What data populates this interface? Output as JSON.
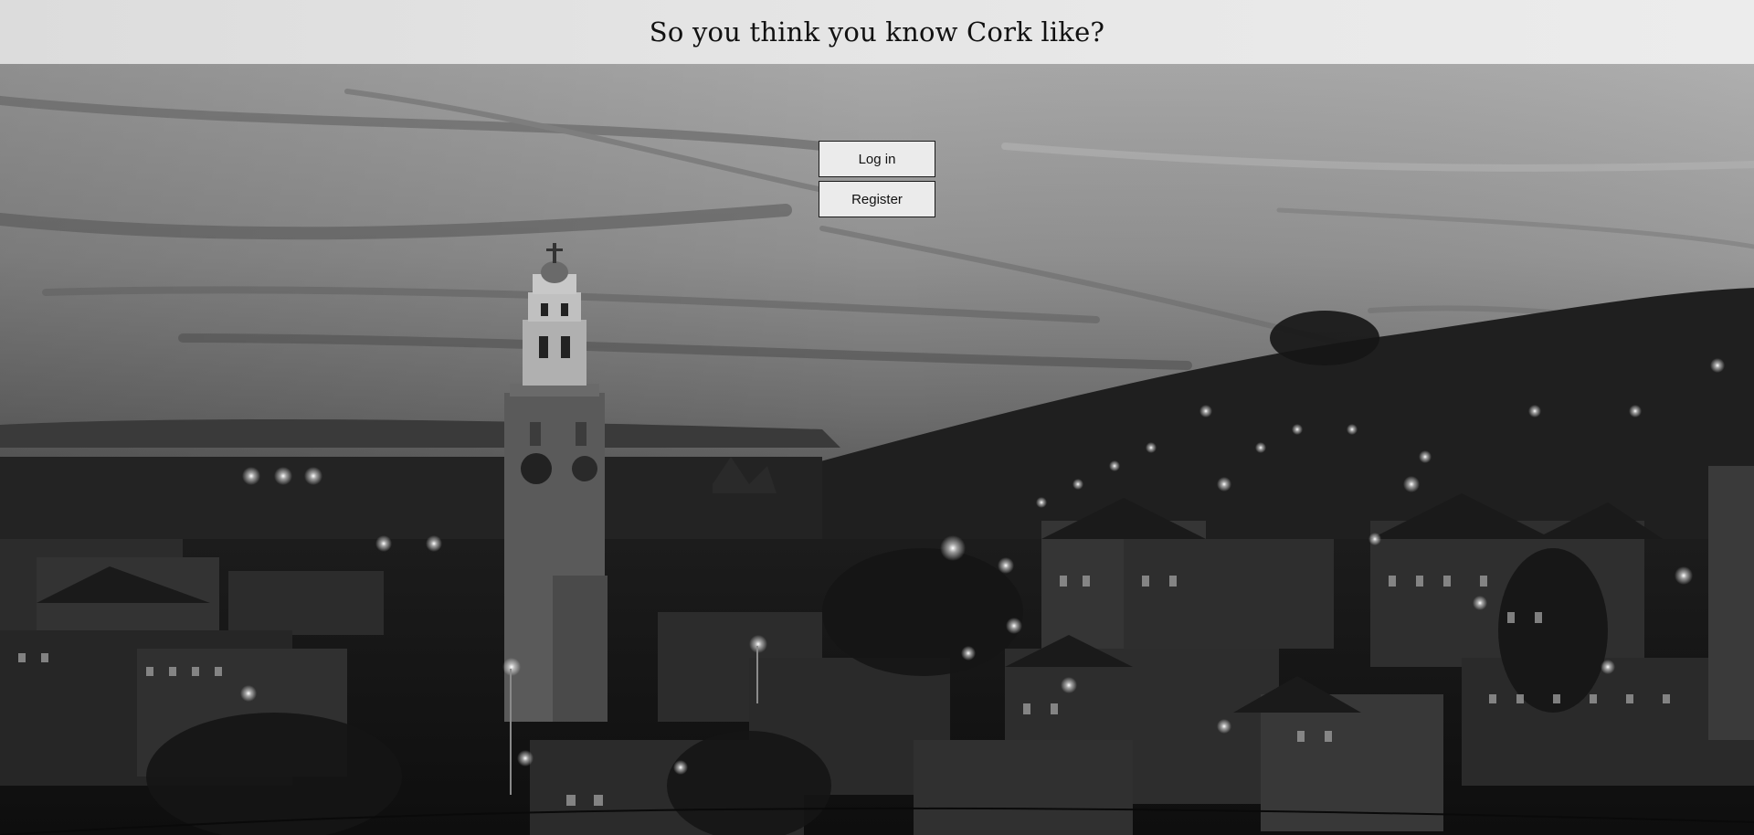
{
  "header": {
    "title": "So you think you know Cork like?"
  },
  "auth": {
    "login_label": "Log in",
    "register_label": "Register"
  },
  "colors": {
    "header_bg": "#e4e4e4",
    "button_bg": "#ebebeb",
    "button_border": "#1b1b1b"
  }
}
